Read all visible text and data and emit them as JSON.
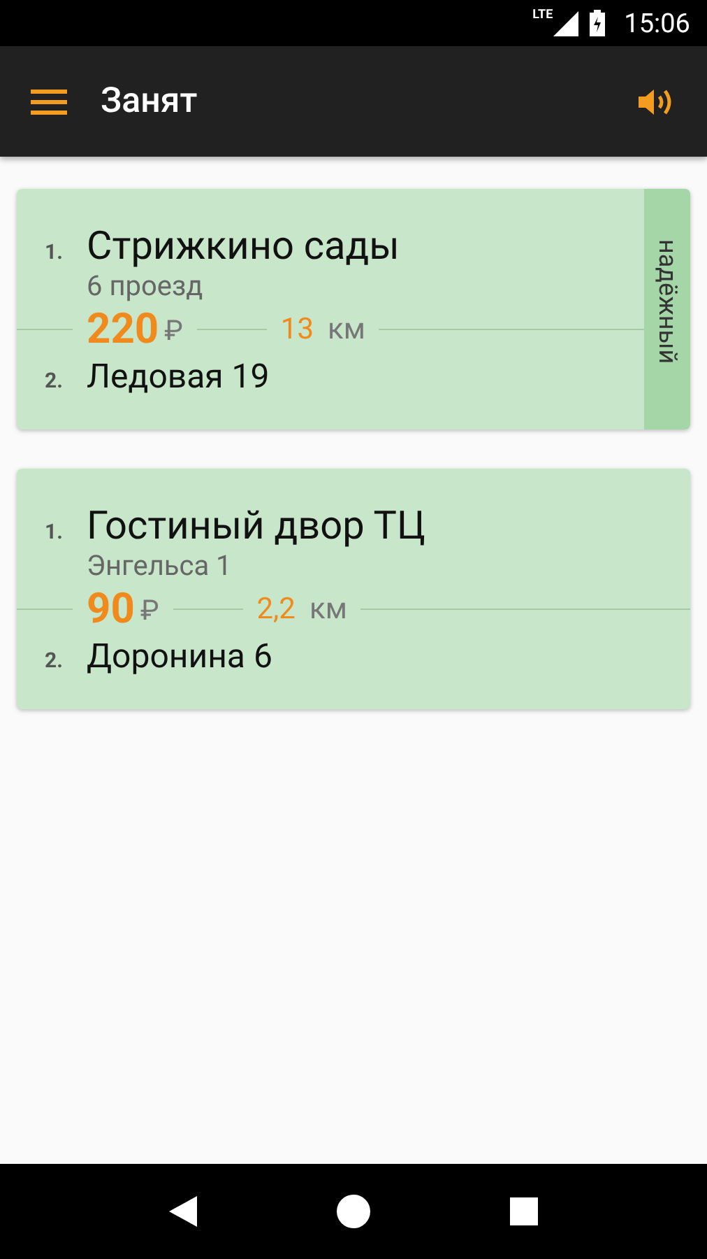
{
  "status_bar": {
    "network": "LTE",
    "time": "15:06"
  },
  "app_bar": {
    "title": "Занят"
  },
  "orders": [
    {
      "from": {
        "number": "1.",
        "name": "Стрижкино сады",
        "detail": "6 проезд"
      },
      "price": "220",
      "currency": "₽",
      "distance": "13",
      "unit": "км",
      "to": {
        "number": "2.",
        "name": "Ледовая 19"
      },
      "badge": "надёжный"
    },
    {
      "from": {
        "number": "1.",
        "name": "Гостиный двор ТЦ",
        "detail": "Энгельса 1"
      },
      "price": "90",
      "currency": "₽",
      "distance": "2,2",
      "unit": "км",
      "to": {
        "number": "2.",
        "name": "Доронина 6"
      }
    }
  ]
}
